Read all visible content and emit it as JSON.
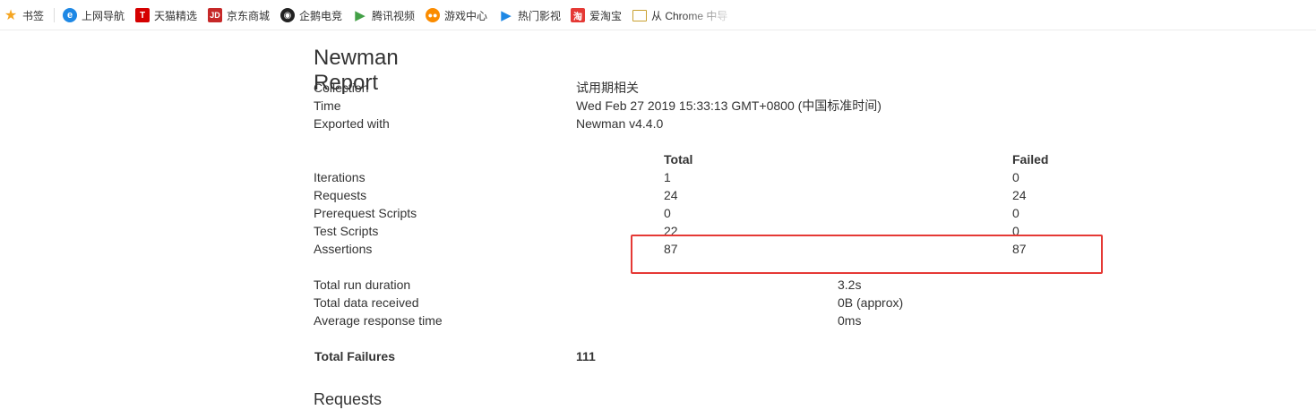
{
  "bookmarks_bar": {
    "items": [
      {
        "label": "书签",
        "icon": "star-icon"
      },
      {
        "label": "上网导航",
        "icon": "ie-icon"
      },
      {
        "label": "天猫精选",
        "icon": "tmall-icon"
      },
      {
        "label": "京东商城",
        "icon": "jd-icon"
      },
      {
        "label": "企鹅电竞",
        "icon": "penguin-icon"
      },
      {
        "label": "腾讯视频",
        "icon": "play-icon"
      },
      {
        "label": "游戏中心",
        "icon": "gamepad-icon"
      },
      {
        "label": "热门影视",
        "icon": "video-icon"
      },
      {
        "label": "爱淘宝",
        "icon": "taobao-icon"
      },
      {
        "label": "从 Chrome 中导",
        "icon": "folder-icon"
      }
    ]
  },
  "report": {
    "title": "Newman Report",
    "info": [
      {
        "label": "Collection",
        "value": "试用期相关"
      },
      {
        "label": "Time",
        "value": "Wed Feb 27 2019 15:33:13 GMT+0800 (中国标准时间)"
      },
      {
        "label": "Exported with",
        "value": "Newman v4.4.0"
      }
    ],
    "stats_headers": {
      "total": "Total",
      "failed": "Failed"
    },
    "stats": [
      {
        "label": "Iterations",
        "total": "1",
        "failed": "0"
      },
      {
        "label": "Requests",
        "total": "24",
        "failed": "24"
      },
      {
        "label": "Prerequest Scripts",
        "total": "0",
        "failed": "0"
      },
      {
        "label": "Test Scripts",
        "total": "22",
        "failed": "0"
      },
      {
        "label": "Assertions",
        "total": "87",
        "failed": "87"
      }
    ],
    "timings": [
      {
        "label": "Total run duration",
        "value": "3.2s"
      },
      {
        "label": "Total data received",
        "value": "0B (approx)"
      },
      {
        "label": "Average response time",
        "value": "0ms"
      }
    ],
    "failures": {
      "label": "Total Failures",
      "value": "111"
    },
    "section_heading": "Requests"
  },
  "colors": {
    "highlight": "#e53935",
    "text": "#333333"
  }
}
